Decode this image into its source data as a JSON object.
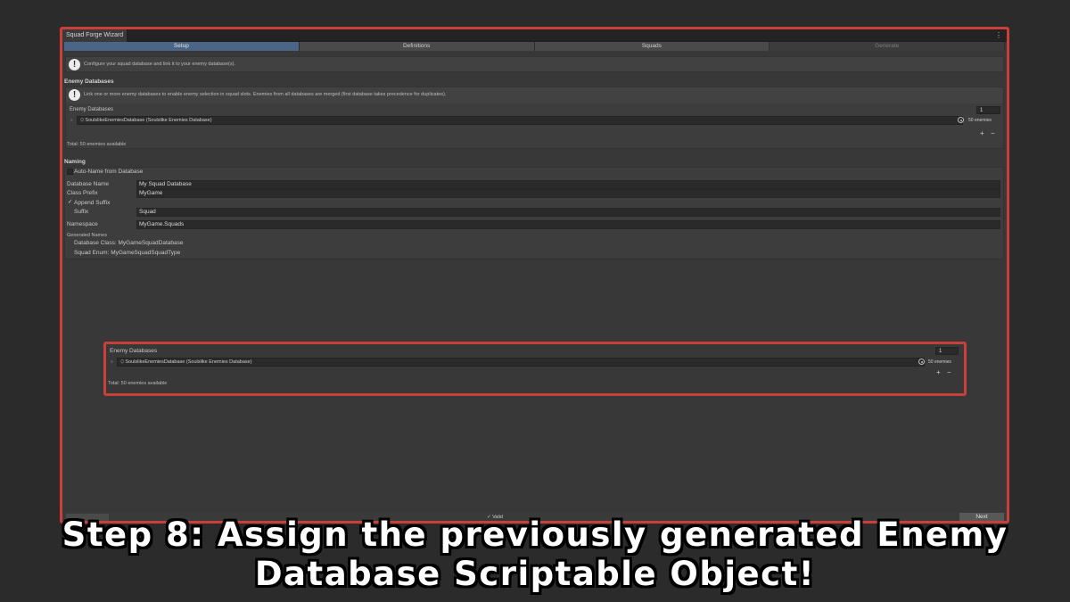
{
  "window": {
    "title": "Squad Forge Wizard",
    "menu_icon": "kebab-menu-icon"
  },
  "tabs": [
    {
      "label": "Setup",
      "state": "active"
    },
    {
      "label": "Definitions",
      "state": "normal"
    },
    {
      "label": "Squads",
      "state": "normal"
    },
    {
      "label": "Generate",
      "state": "disabled"
    }
  ],
  "intro_help": "Configure your squad database and link it to your enemy database(s).",
  "enemy_section": {
    "title": "Enemy Databases",
    "help": "Link one or more enemy databases to enable enemy selection in squad slots. Enemies from all databases are merged (first database takes precedence for duplicates).",
    "list_label": "Enemy Databases",
    "list_size": "1",
    "items": [
      {
        "name": "SoulslikeEnemiesDatabase (Soulslike Enemies Database)",
        "count": "50 enemies"
      }
    ],
    "add_label": "+",
    "remove_label": "−",
    "total": "Total: 50 enemies available"
  },
  "naming": {
    "title": "Naming",
    "auto_name_label": "Auto-Name from Database",
    "auto_name_checked": false,
    "database_name_label": "Database Name",
    "database_name_value": "My Squad Database",
    "class_prefix_label": "Class Prefix",
    "class_prefix_value": "MyGame",
    "append_suffix_label": "Append Suffix",
    "append_suffix_checked": true,
    "append_suffix_mark": "✓",
    "suffix_label": "Suffix",
    "suffix_value": "Squad",
    "namespace_label": "Namespace",
    "namespace_value": "MyGame.Squads",
    "generated_title": "Generated Names",
    "generated_class": "Database Class: MyGameSquadDatabase",
    "generated_enum": "Squad Enum: MyGameSquadSquadType"
  },
  "footer": {
    "valid_text": "✓ Valid",
    "next_label": "Next"
  },
  "caption": {
    "line1": "Step 8: Assign the previously generated Enemy",
    "line2": "Database Scriptable Object!"
  },
  "colors": {
    "highlight_border": "#c9403a",
    "active_tab": "#4b6586",
    "background": "#2b2b2b",
    "panel": "#383838"
  }
}
